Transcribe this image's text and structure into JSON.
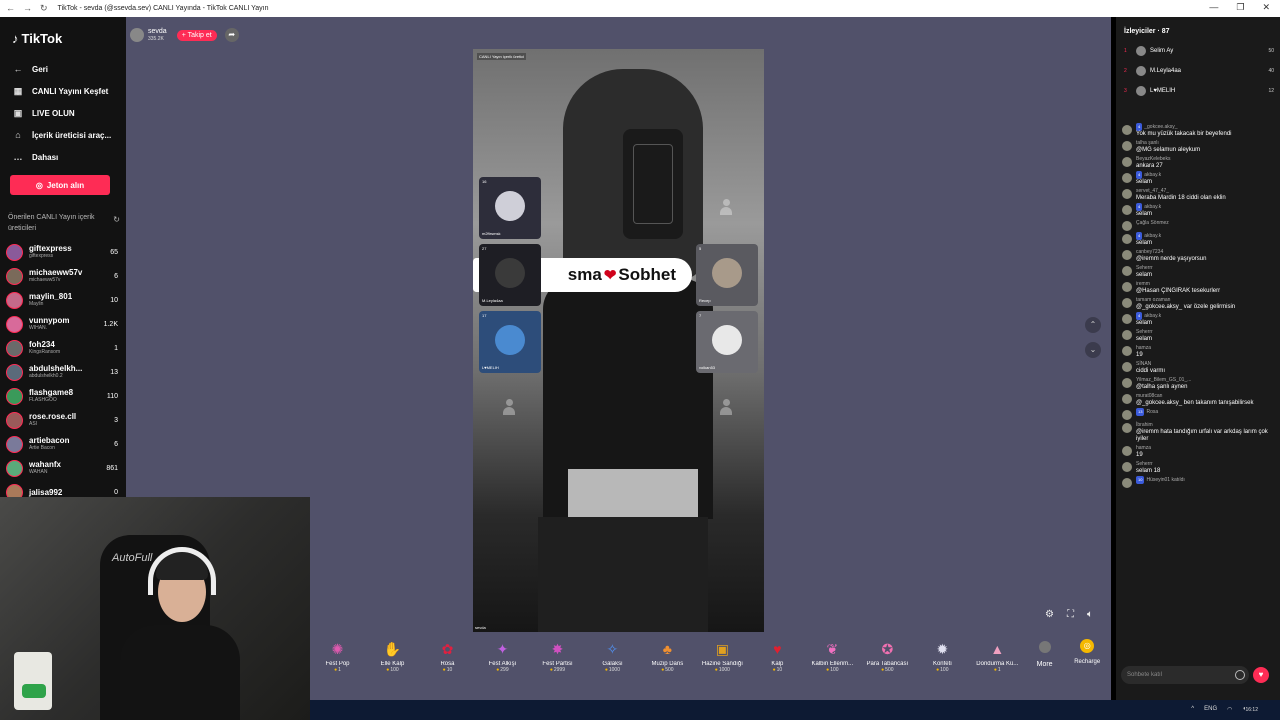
{
  "browser": {
    "title": "TikTok - sevda (@ssevda.sev) CANLI Yayında - TikTok CANLI Yayın",
    "nav": [
      "←",
      "→",
      "↻"
    ],
    "controls": [
      "—",
      "❐",
      "✕"
    ]
  },
  "sidebar": {
    "logo": "TikTok",
    "items": [
      {
        "icon": "←",
        "label": "Geri"
      },
      {
        "icon": "▦",
        "label": "CANLI Yayını Keşfet"
      },
      {
        "icon": "▣",
        "label": "LIVE OLUN"
      },
      {
        "icon": "⌂",
        "label": "İçerik üreticisi araç..."
      },
      {
        "icon": "…",
        "label": "Dahası"
      }
    ],
    "jeton": "Jeton alın",
    "suggested_heading": "Önerilen CANLI Yayın içerik üreticileri",
    "suggested": [
      {
        "name": "giftexpress",
        "sub": "giftexpress",
        "count": "65",
        "color": "#8a5a9a"
      },
      {
        "name": "michaeww57v",
        "sub": "michaeww57v",
        "count": "6",
        "color": "#7a6a5a"
      },
      {
        "name": "maylin_801",
        "sub": "Maylin",
        "count": "10",
        "color": "#c46a8a"
      },
      {
        "name": "vunnypom",
        "sub": "WIHAN.",
        "count": "1.2K",
        "color": "#d86a9a"
      },
      {
        "name": "foh234",
        "sub": "KingsRansom",
        "count": "1",
        "color": "#6a6a6a"
      },
      {
        "name": "abdulshelkh...",
        "sub": "abdulshelkh0.2",
        "count": "13",
        "color": "#5a6a7a"
      },
      {
        "name": "flashgame8",
        "sub": "FLASHGOO",
        "count": "110",
        "color": "#3a9a5a"
      },
      {
        "name": "rose.rose.cll",
        "sub": "ASI",
        "count": "3",
        "color": "#9a5a5a"
      },
      {
        "name": "artiebacon",
        "sub": "Artie Bacon",
        "count": "6",
        "color": "#7a7a9a"
      },
      {
        "name": "wahanfx",
        "sub": "WAHAN",
        "count": "861",
        "color": "#5aaa7a"
      },
      {
        "name": "jalisa992",
        "sub": "",
        "count": "0",
        "color": "#aa7a5a"
      }
    ]
  },
  "stream": {
    "host_name": "sevda",
    "host_count": "335.2K",
    "follow": "+ Takip et",
    "note": "CANLI Yayın içerik üretici",
    "host_label": "sevda",
    "banner_text_a": "sma",
    "banner_heart": "❤",
    "banner_text_b": "Sobhet",
    "guests": [
      {
        "count": "16",
        "name": "m2ftrsmsk"
      },
      {
        "count": "27",
        "name": "M.Leyla4aa"
      },
      {
        "count": "17",
        "name": "L♥MELIH"
      },
      {
        "count": "5",
        "name": "Recep"
      },
      {
        "count": "7",
        "name": "volkan53"
      }
    ]
  },
  "gifts": [
    {
      "name": "Fest Pop",
      "price": "1",
      "icon": "✺",
      "color": "#e05ab0"
    },
    {
      "name": "Elle Kalp",
      "price": "100",
      "icon": "✋",
      "color": "#f08ab0"
    },
    {
      "name": "Rosa",
      "price": "10",
      "icon": "✿",
      "color": "#e02040"
    },
    {
      "name": "Fest Alkışı",
      "price": "299",
      "icon": "✦",
      "color": "#c060e0"
    },
    {
      "name": "Fest Partisi",
      "price": "2999",
      "icon": "✸",
      "color": "#d050c0"
    },
    {
      "name": "Galaksi",
      "price": "1000",
      "icon": "✧",
      "color": "#5090f0"
    },
    {
      "name": "Muzip Dans",
      "price": "500",
      "icon": "♣",
      "color": "#f09030"
    },
    {
      "name": "Hazine Sandığı",
      "price": "1000",
      "icon": "▣",
      "color": "#e0a020"
    },
    {
      "name": "Kalp",
      "price": "10",
      "icon": "♥",
      "color": "#e02030"
    },
    {
      "name": "Kalbin Ellerim...",
      "price": "100",
      "icon": "❦",
      "color": "#f070c0"
    },
    {
      "name": "Para Tabancası",
      "price": "500",
      "icon": "✪",
      "color": "#f070b0"
    },
    {
      "name": "Konfeti",
      "price": "100",
      "icon": "✹",
      "color": "#e0e0f0"
    },
    {
      "name": "Dondurma Kü...",
      "price": "1",
      "icon": "▲",
      "color": "#f0a0c0"
    }
  ],
  "more_label": "More",
  "recharge_label": "Recharge",
  "right": {
    "viewers_label": "İzleyiciler · 87",
    "top_viewers": [
      {
        "rank": "1",
        "name": "Selim Ay",
        "score": "50"
      },
      {
        "rank": "2",
        "name": "M.Leyla4aa",
        "score": "40"
      },
      {
        "rank": "3",
        "name": "L♥MELIH",
        "score": "12"
      }
    ],
    "chat": [
      {
        "user": "_gokcee.aksy_",
        "text": "Yok mu yüzük takacak bir beyefendi",
        "badge": "4"
      },
      {
        "user": "talha şanlı",
        "text": "@MG selamun aleykum",
        "badge": ""
      },
      {
        "user": "BeyazKelebeks",
        "text": "ankara 27",
        "badge": ""
      },
      {
        "user": "akbay.k",
        "text": "selam",
        "badge": "4"
      },
      {
        "user": "servet_47_47_",
        "text": "Meraba Mardin 18 ciddi olan eklin",
        "badge": ""
      },
      {
        "user": "akbay.k",
        "text": "selam",
        "badge": "4"
      },
      {
        "user": "Çağla Sönmez",
        "text": "",
        "badge": ""
      },
      {
        "user": "akbay.k",
        "text": "selam",
        "badge": "4"
      },
      {
        "user": "canbey7234",
        "text": "@iremm nerde yaşıyorsun",
        "badge": ""
      },
      {
        "user": "Seherrr",
        "text": "selam",
        "badge": ""
      },
      {
        "user": "iremm",
        "text": "@Hasan ÇINGIRAK tesekurlerr",
        "badge": ""
      },
      {
        "user": "tamam ozaman",
        "text": "@_gokcee.aksy_ var özele gelirmisin",
        "badge": ""
      },
      {
        "user": "akbay.k",
        "text": "selam",
        "badge": "4"
      },
      {
        "user": "Seherrr",
        "text": "selam",
        "badge": ""
      },
      {
        "user": "hamza",
        "text": "19",
        "badge": ""
      },
      {
        "user": "SİNAN",
        "text": "ciddi varmı",
        "badge": ""
      },
      {
        "user": "Yilmaz_Bilem_GS_01_...",
        "text": "@talha şanlı aynen",
        "badge": ""
      },
      {
        "user": "murat08can",
        "text": "@_gokcee.aksy_ ben takanım tanışabilirsek",
        "badge": ""
      },
      {
        "user": "Rosa",
        "text": "",
        "badge": "13"
      },
      {
        "user": "İbrahim",
        "text": "@iremm hata tandığım urfalı var arkdaş larım çok iyiler",
        "badge": ""
      },
      {
        "user": "hamza",
        "text": "19",
        "badge": ""
      },
      {
        "user": "Seherrr",
        "text": "selam 18",
        "badge": ""
      },
      {
        "user": "Hüseyin01 katıldı",
        "text": "",
        "badge": "10"
      }
    ],
    "input_placeholder": "Sohbete katıl"
  },
  "taskbar": {
    "lang": "ENG",
    "time": "16:12"
  }
}
